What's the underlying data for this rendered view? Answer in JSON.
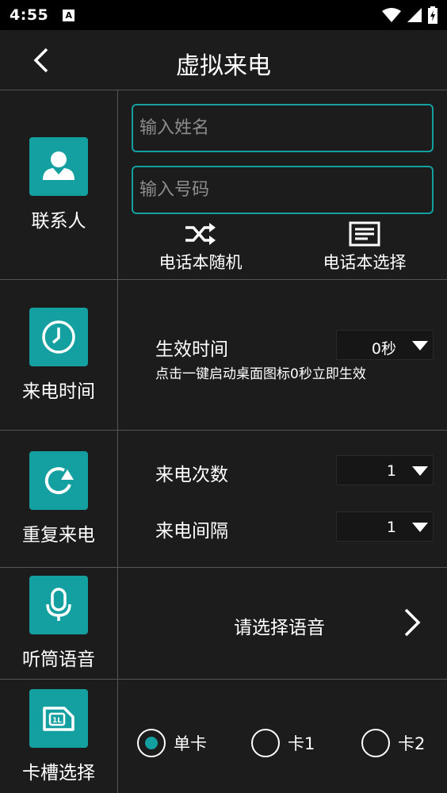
{
  "status_bar": {
    "time": "4:55",
    "a_icon": "A"
  },
  "header": {
    "title": "虚拟来电"
  },
  "contact": {
    "label": "联系人",
    "name_placeholder": "输入姓名",
    "number_placeholder": "输入号码",
    "random_label": "电话本随机",
    "select_label": "电话本选择"
  },
  "call_time": {
    "label": "来电时间",
    "effective_label": "生效时间",
    "effective_value": "0秒",
    "note": "点击一键启动桌面图标0秒立即生效"
  },
  "repeat": {
    "label": "重复来电",
    "count_label": "来电次数",
    "count_value": "1",
    "interval_label": "来电间隔",
    "interval_value": "1"
  },
  "voice": {
    "label": "听筒语音",
    "select_label": "请选择语音"
  },
  "sim": {
    "label": "卡槽选择",
    "chip_text": "1L",
    "options": [
      {
        "label": "单卡",
        "selected": true
      },
      {
        "label": "卡1",
        "selected": false
      },
      {
        "label": "卡2",
        "selected": false
      }
    ]
  },
  "colors": {
    "accent": "#14a0a0",
    "background": "#1c1c1c",
    "statusbar": "#000000"
  }
}
